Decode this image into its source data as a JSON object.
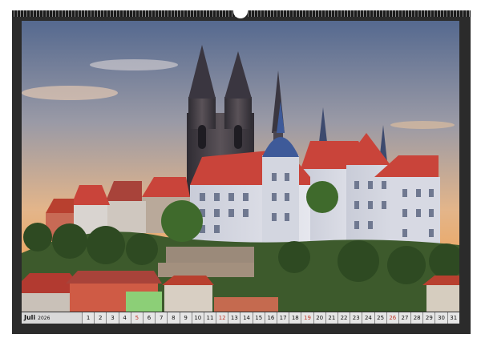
{
  "calendar": {
    "month": "Juli",
    "year": "2026",
    "days": [
      "1",
      "2",
      "3",
      "4",
      "5",
      "6",
      "7",
      "8",
      "9",
      "10",
      "11",
      "12",
      "13",
      "14",
      "15",
      "16",
      "17",
      "18",
      "19",
      "20",
      "21",
      "22",
      "23",
      "24",
      "25",
      "26",
      "27",
      "28",
      "29",
      "30",
      "31"
    ],
    "highlighted_days": [
      "5",
      "12",
      "19",
      "26"
    ]
  },
  "colors": {
    "frame": "#2b2b2b",
    "date_strip": "#d9d9d9",
    "sunday_highlight": "#c0392b",
    "sky_top": "#5b6f93",
    "sky_bottom": "#f1a24f",
    "roof_red": "#c9443a",
    "wall_white": "#d9dbe4",
    "spire_dark": "#3a3640"
  }
}
